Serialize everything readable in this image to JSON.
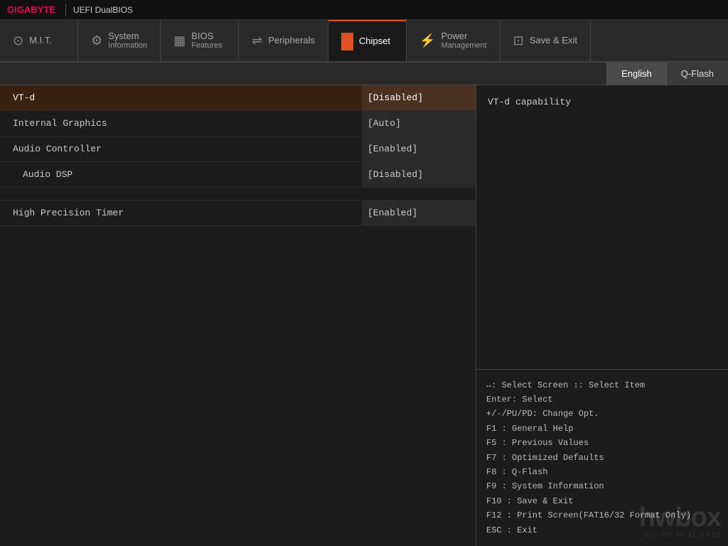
{
  "header": {
    "brand": "GIGABYTE",
    "uefi_label": "UEFI DualBIOS"
  },
  "nav": {
    "tabs": [
      {
        "id": "mit",
        "icon": "⊙",
        "label": "M.I.T.",
        "sublabel": "",
        "active": false
      },
      {
        "id": "system-info",
        "icon": "⚙",
        "label": "System",
        "sublabel": "Information",
        "active": false
      },
      {
        "id": "bios-features",
        "icon": "▦",
        "label": "BIOS",
        "sublabel": "Features",
        "active": false
      },
      {
        "id": "peripherals",
        "icon": "⇌",
        "label": "Peripherals",
        "sublabel": "",
        "active": false
      },
      {
        "id": "chipset",
        "icon": "■",
        "label": "Chipset",
        "sublabel": "",
        "active": true
      },
      {
        "id": "power-mgmt",
        "icon": "⚡",
        "label": "Power",
        "sublabel": "Management",
        "active": false
      },
      {
        "id": "save-exit",
        "icon": "⊡",
        "label": "Save & Exit",
        "sublabel": "",
        "active": false
      }
    ]
  },
  "lang_bar": {
    "english_label": "English",
    "qflash_label": "Q-Flash"
  },
  "settings": {
    "rows": [
      {
        "name": "VT-d",
        "value": "[Disabled]",
        "indented": false,
        "selected": true
      },
      {
        "name": "Internal Graphics",
        "value": "[Auto]",
        "indented": false,
        "selected": false
      },
      {
        "name": "Audio Controller",
        "value": "[Enabled]",
        "indented": false,
        "selected": false
      },
      {
        "name": "Audio DSP",
        "value": "[Disabled]",
        "indented": true,
        "selected": false
      }
    ],
    "spacer": true,
    "rows2": [
      {
        "name": "High Precision Timer",
        "value": "[Enabled]",
        "indented": false,
        "selected": false
      }
    ]
  },
  "help": {
    "text": "VT-d capability"
  },
  "shortcuts": {
    "lines": [
      "↔: Select Screen  ↕: Select Item",
      "Enter: Select",
      "+/-/PU/PD: Change Opt.",
      "F1   : General Help",
      "F5   : Previous Values",
      "F7   : Optimized Defaults",
      "F8   : Q-Flash",
      "F9   : System Information",
      "F10  : Save & Exit",
      "F12  : Print Screen(FAT16/32 Format Only)",
      "ESC  : Exit"
    ]
  },
  "watermark": {
    "text": "hwbox",
    "subtext": "o/c on first boot"
  }
}
